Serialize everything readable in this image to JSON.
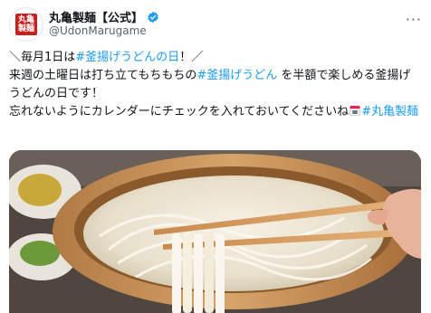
{
  "author": {
    "display_name": "丸亀製麺【公式】",
    "handle": "@UdonMarugame",
    "logo_text_top": "丸亀",
    "logo_text_bottom": "製麺"
  },
  "tweet": {
    "line1_pre": "＼毎月1日は",
    "line1_tag": "#釜揚げうどんの日",
    "line1_post": "！／",
    "line2_pre": "来週の土曜日は打ち立てもちもちの",
    "line2_tag": "#釜揚げうどん",
    "line2_post": "を半額で楽しめる釜揚げうどんの日です！",
    "line3_pre": "忘れないようにカレンダーにチェックを入れておいてくださいね",
    "line3_tag": "#丸亀製麺"
  },
  "icons": {
    "verified": "verified-badge-icon",
    "calendar": "calendar-emoji-icon",
    "more": "more-icon"
  },
  "colors": {
    "link": "#1d9bf0",
    "brand": "#c8201e"
  }
}
